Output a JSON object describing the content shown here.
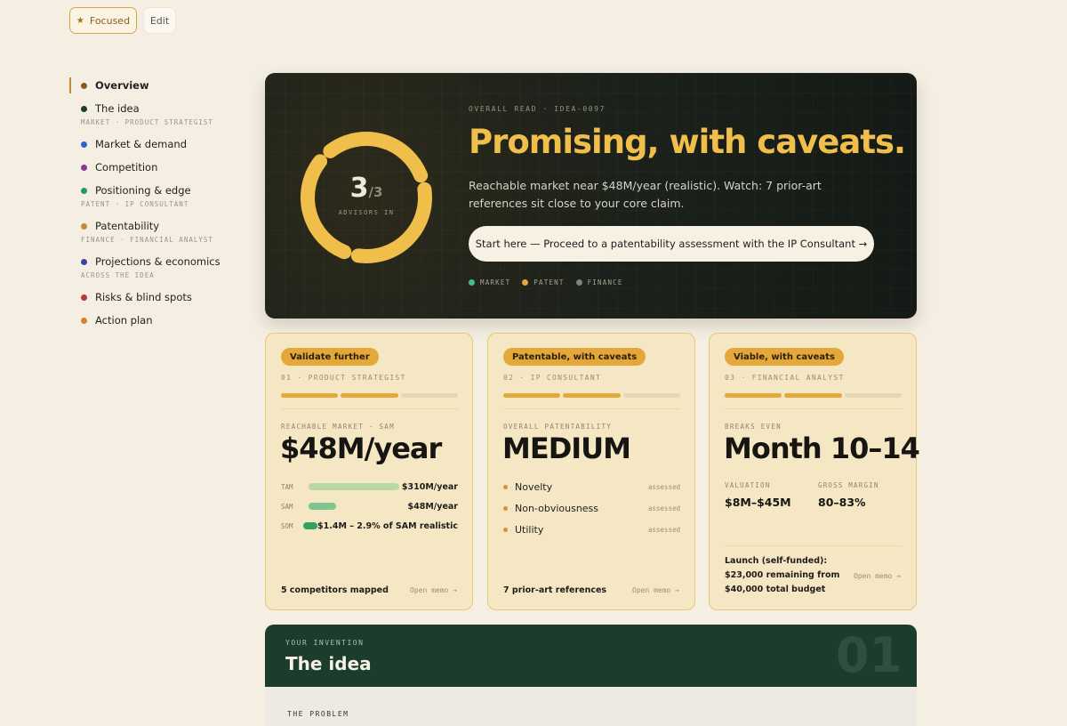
{
  "toolbar": {
    "focused_label": "Focused",
    "edit_label": "Edit"
  },
  "sidebar": {
    "items": [
      {
        "label": "Overview",
        "color": "#8a5a1a"
      },
      {
        "label": "The idea",
        "color": "#1e3d2b"
      },
      {
        "label": "Market & demand",
        "color": "#2f5fd0"
      },
      {
        "label": "Competition",
        "color": "#8a3a8a"
      },
      {
        "label": "Positioning & edge",
        "color": "#1f9a66"
      },
      {
        "label": "Patentability",
        "color": "#c48a3a"
      },
      {
        "label": "Projections & economics",
        "color": "#3b45a0"
      },
      {
        "label": "Risks & blind spots",
        "color": "#b33a3a"
      },
      {
        "label": "Action plan",
        "color": "#d4822e"
      }
    ],
    "groups": [
      "MARKET · PRODUCT STRATEGIST",
      "PATENT · IP CONSULTANT",
      "FINANCE · FINANCIAL ANALYST",
      "ACROSS THE IDEA"
    ]
  },
  "hero": {
    "advisors_count": "3",
    "advisors_total": "/3",
    "advisors_caption": "ADVISORS IN",
    "eyebrow": "OVERALL READ · IDEA-0097",
    "title": "Promising, with caveats.",
    "description": "Reachable market near $48M/year (realistic). Watch: 7 prior-art references sit close to your core claim.",
    "cta": "Start here — Proceed to a patentability assessment with the IP Consultant →",
    "legend": [
      {
        "label": "MARKET",
        "color": "#3fc28a"
      },
      {
        "label": "PATENT",
        "color": "#e4a83a"
      },
      {
        "label": "FINANCE",
        "color": "#7e857d"
      }
    ],
    "ring_color": "#f0be4a"
  },
  "cards": [
    {
      "badge": "Validate further",
      "eyebrow": "01 · PRODUCT STRATEGIST",
      "progress": 0.67,
      "metric_label": "REACHABLE MARKET · SAM",
      "metric_value": "$48M/year",
      "bars": [
        {
          "key": "TAM",
          "value": "$310M/year",
          "color": "#b9d8a3"
        },
        {
          "key": "SAM",
          "value": "$48M/year",
          "color": "#7fc68e"
        },
        {
          "key": "SOM",
          "value": "$1.4M – 2.9% of SAM realistic",
          "color": "#2fa35f"
        }
      ],
      "footer": "5 competitors mapped",
      "open_memo": "Open memo →"
    },
    {
      "badge": "Patentable, with caveats",
      "eyebrow": "02 · IP CONSULTANT",
      "progress": 0.67,
      "metric_label": "OVERALL PATENTABILITY",
      "metric_value": "MEDIUM",
      "criteria": [
        {
          "label": "Novelty",
          "status": "assessed"
        },
        {
          "label": "Non-obviousness",
          "status": "assessed"
        },
        {
          "label": "Utility",
          "status": "assessed"
        }
      ],
      "footer": "7 prior-art references",
      "open_memo": "Open memo →"
    },
    {
      "badge": "Viable, with caveats",
      "eyebrow": "03 · FINANCIAL ANALYST",
      "progress": 0.67,
      "metric_label": "BREAKS EVEN",
      "metric_value": "Month 10–14",
      "valuation_label": "VALUATION",
      "valuation_value": "$8M–$45M",
      "margin_label": "GROSS MARGIN",
      "margin_value": "80–83%",
      "launch_line1": "Launch (self-funded):",
      "launch_line2": "$23,000 remaining from",
      "launch_line3": "$40,000 total budget",
      "open_memo": "Open memo →"
    }
  ],
  "idea": {
    "eyebrow": "YOUR INVENTION",
    "title": "The idea",
    "number": "01",
    "problem_label": "THE PROBLEM"
  }
}
